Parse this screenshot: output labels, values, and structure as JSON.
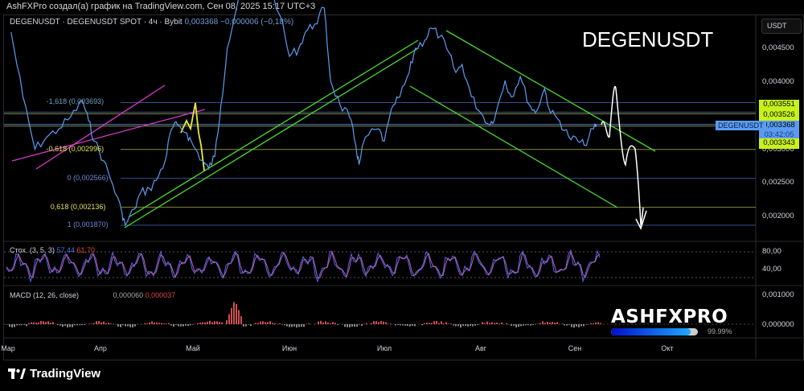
{
  "header": {
    "caption": "AshFXPro создал(а) график на TradingView.com, Сен 08, 2025 15:17 UTC+3"
  },
  "legend": {
    "symbol": "DEGENUSDT · DEGENUSDT SPOT · 4ч · Bybit",
    "price": "0,003368",
    "change": "−0,000006 (−0,18%)"
  },
  "big_title": "DEGENUSDT",
  "currency_button": "USDT",
  "price_axis": {
    "ticks": [
      "0,004500",
      "0,004000",
      "0,003000",
      "0,002500",
      "0,002000"
    ]
  },
  "tags": {
    "level_1": "0,003551",
    "level_2": "0,003526",
    "symbol": "DEGENUSDT",
    "price": "0,003368",
    "countdown": "03:42:05",
    "level_3": "0,003343"
  },
  "fib_levels": [
    {
      "label": "-1,618 (0,003693)",
      "value": 0.003693,
      "color": "#6aa3c8"
    },
    {
      "label": "-0,618 (0,002996)",
      "value": 0.002996,
      "color": "#e6e35a"
    },
    {
      "label": "0 (0,002566)",
      "value": 0.002566,
      "color": "#6f86d8"
    },
    {
      "label": "0,618 (0,002136)",
      "value": 0.002136,
      "color": "#e6e35a"
    },
    {
      "label": "1 (0,001870)",
      "value": 0.00187,
      "color": "#6f86d8"
    }
  ],
  "stoch": {
    "label": "Стох. (3, 5, 3)",
    "k": "57,44",
    "d": "61,70",
    "ticks": [
      "80,00",
      "40,00"
    ]
  },
  "macd": {
    "label": "MACD (12, 26, close)",
    "v1": "0,000060",
    "v2": "0,000037",
    "ticks": [
      "0,001000",
      "0,000000"
    ]
  },
  "months": [
    "Мар",
    "Апр",
    "Май",
    "Июн",
    "Июл",
    "Авг",
    "Сен",
    "Окт"
  ],
  "watermark": {
    "brand": "ASHFXPRO",
    "progress_label": "99.99%",
    "progress": 0.9999
  },
  "footer": {
    "logo": "TradingView"
  },
  "colors": {
    "price_line": "#5b9cf0",
    "accent_yellow": "#c8f21a",
    "fib_blue": "#3a4f8a",
    "channel_green": "#4cd632",
    "trend_magenta": "#d83ac8"
  },
  "chart_data": {
    "type": "line",
    "symbol": "DEGENUSDT",
    "ylim": [
      0.0018,
      0.0053
    ],
    "series": [
      {
        "x": [
          "2025-03-02",
          "2025-03-06",
          "2025-03-10",
          "2025-03-14",
          "2025-03-18",
          "2025-03-22",
          "2025-03-26",
          "2025-03-28",
          "2025-03-30",
          "2025-04-02",
          "2025-04-05",
          "2025-04-08",
          "2025-04-09",
          "2025-04-12",
          "2025-04-14",
          "2025-04-17",
          "2025-04-19",
          "2025-04-22",
          "2025-04-24",
          "2025-04-26",
          "2025-04-29",
          "2025-05-01",
          "2025-05-04",
          "2025-05-06",
          "2025-05-08",
          "2025-05-10",
          "2025-05-12",
          "2025-05-15",
          "2025-05-18",
          "2025-05-24",
          "2025-05-29",
          "2025-06-01",
          "2025-06-04",
          "2025-06-06",
          "2025-06-09",
          "2025-06-12",
          "2025-06-14",
          "2025-06-17",
          "2025-06-20",
          "2025-06-22",
          "2025-06-23",
          "2025-06-25",
          "2025-06-29",
          "2025-07-01",
          "2025-07-04",
          "2025-07-06",
          "2025-07-09",
          "2025-07-11",
          "2025-07-14",
          "2025-07-16",
          "2025-07-19",
          "2025-07-21",
          "2025-07-24",
          "2025-07-26",
          "2025-07-29",
          "2025-08-01",
          "2025-08-04",
          "2025-08-06",
          "2025-08-09",
          "2025-08-11",
          "2025-08-14",
          "2025-08-17",
          "2025-08-19",
          "2025-08-22",
          "2025-08-24",
          "2025-08-27",
          "2025-08-30",
          "2025-09-02",
          "2025-09-04",
          "2025-09-07",
          "2025-09-08"
        ],
        "y": [
          0.00474,
          0.00378,
          0.003,
          0.00318,
          0.0033,
          0.00348,
          0.00372,
          0.00342,
          0.00312,
          0.00283,
          0.00247,
          0.00205,
          0.00187,
          0.00211,
          0.00235,
          0.00241,
          0.00253,
          0.00283,
          0.0033,
          0.00336,
          0.00324,
          0.00306,
          0.00283,
          0.00271,
          0.00289,
          0.00366,
          0.0045,
          0.0051,
          0.00546,
          0.0057,
          0.00498,
          0.00438,
          0.0045,
          0.00474,
          0.00486,
          0.0051,
          0.00402,
          0.00366,
          0.00348,
          0.00306,
          0.00277,
          0.00318,
          0.0033,
          0.00312,
          0.00366,
          0.00378,
          0.00414,
          0.0045,
          0.00462,
          0.0048,
          0.00468,
          0.0045,
          0.00414,
          0.00426,
          0.00378,
          0.00354,
          0.00336,
          0.00354,
          0.00402,
          0.00378,
          0.00408,
          0.00366,
          0.00354,
          0.0039,
          0.00354,
          0.00342,
          0.00318,
          0.00312,
          0.00306,
          0.0033,
          0.003368
        ]
      }
    ]
  }
}
